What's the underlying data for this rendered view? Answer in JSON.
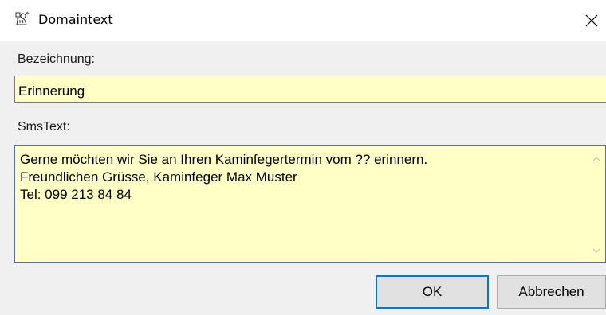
{
  "window": {
    "title": "Domaintext",
    "app_icon": "chimney-sweep-icon",
    "close_icon": "close-icon"
  },
  "form": {
    "name_label": "Bezeichnung:",
    "name_value": "Erinnerung",
    "sms_label": "SmsText:",
    "sms_value": "Gerne möchten wir Sie an Ihren Kaminfegertermin vom ?? erinnern.\nFreundlichen Grüsse, Kaminfeger Max Muster\nTel: 099 213 84 84"
  },
  "buttons": {
    "ok_label": "OK",
    "cancel_label": "Abbrechen"
  },
  "colors": {
    "field_background": "#ffffc6",
    "dialog_background": "#f0f0f0",
    "default_button_border": "#0078d7"
  }
}
